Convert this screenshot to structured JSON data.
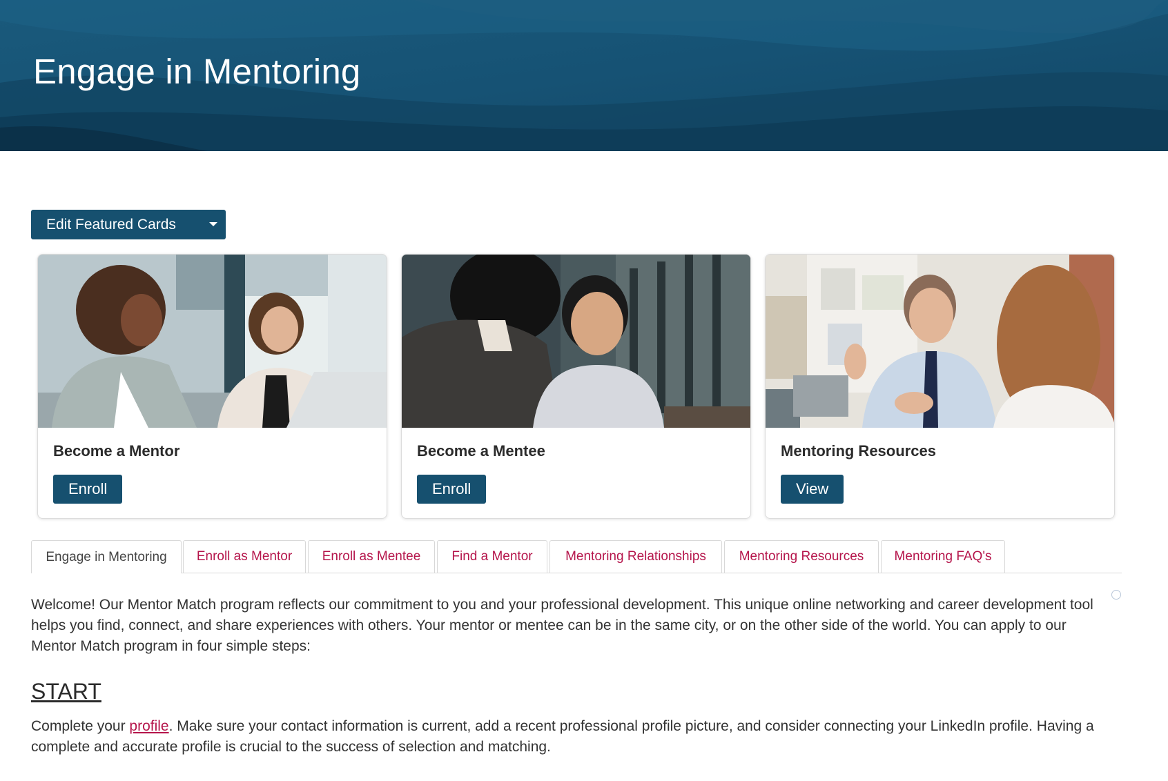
{
  "banner": {
    "title": "Engage in Mentoring"
  },
  "toolbar": {
    "edit_cards_label": "Edit Featured Cards"
  },
  "cards": [
    {
      "title": "Become a Mentor",
      "button": "Enroll"
    },
    {
      "title": "Become a Mentee",
      "button": "Enroll"
    },
    {
      "title": "Mentoring Resources",
      "button": "View"
    }
  ],
  "tabs": [
    {
      "label": "Engage in Mentoring",
      "active": true
    },
    {
      "label": "Enroll as Mentor"
    },
    {
      "label": "Enroll as Mentee"
    },
    {
      "label": "Find a Mentor"
    },
    {
      "label": "Mentoring Relationships"
    },
    {
      "label": "Mentoring Resources"
    },
    {
      "label": "Mentoring FAQ's"
    }
  ],
  "content": {
    "intro": "Welcome! Our Mentor Match program reflects our commitment to you and your professional development. This unique online networking and career development tool helps you find, connect, and share experiences with others. Your mentor or mentee can be in the same city, or on the other side of the world. You can apply to our Mentor Match program in four simple steps:",
    "start_heading": "START",
    "start_before": "Complete your ",
    "start_link": "profile",
    "start_after": ". Make sure your contact information is current, add a recent professional profile picture, and consider connecting your LinkedIn profile. Having a complete and accurate profile is crucial to the success of selection and matching."
  },
  "colors": {
    "brand": "#16506f",
    "link": "#b5154b"
  }
}
